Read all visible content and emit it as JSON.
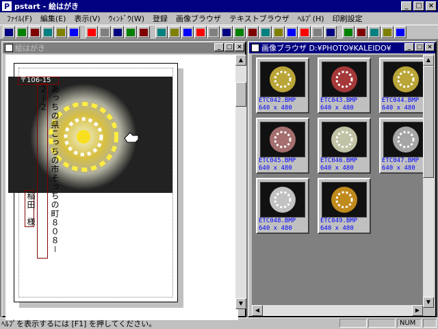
{
  "app": {
    "title": "pstart - 絵はがき"
  },
  "menu": [
    "ﾌｧｲﾙ(F)",
    "編集(E)",
    "表示(V)",
    "ｳｨﾝﾄﾞｳ(W)",
    "登録",
    "画像ブラウザ",
    "テキストブラウザ",
    "ﾍﾙﾌﾟ(H)",
    "印刷設定"
  ],
  "toolbar_icons": [
    "new-icon",
    "open-icon",
    "save-icon",
    "save-all-icon",
    "print-icon",
    "print-preview-icon",
    "page-icon",
    "move-down-icon",
    "move-all-icon",
    "flip-icon",
    "paste-icon",
    "align-top-icon",
    "align-middle-icon",
    "align-width-icon",
    "triangle-icon",
    "align-left-icon",
    "align-center-icon",
    "align-right-icon",
    "align-bottom-icon",
    "distribute-icon",
    "stretch-icon",
    "fit-icon",
    "group-icon",
    "ungroup-icon",
    "order-icon",
    "text-icon",
    "style-icon",
    "vertical-text-icon",
    "horizontal-text-icon",
    "help-icon"
  ],
  "left_window": {
    "title": "絵はがき",
    "postal": "〒106-15",
    "address": "あっちの県こっちの市そっちの町８０８－２－２",
    "name_a": "稲田",
    "name_b": "様"
  },
  "right_window": {
    "title": "画像ブラウザ D:¥PHOTO¥KALEIDO¥",
    "items": [
      {
        "file": "ETC042.BMP",
        "size": "640 x 480"
      },
      {
        "file": "ETC043.BMP",
        "size": "640 x 480"
      },
      {
        "file": "ETC044.BMP",
        "size": "640 x 480"
      },
      {
        "file": "ETC045.BMP",
        "size": "640 x 480"
      },
      {
        "file": "ETC046.BMP",
        "size": "640 x 480"
      },
      {
        "file": "ETC047.BMP",
        "size": "640 x 480"
      },
      {
        "file": "ETC048.BMP",
        "size": "640 x 480"
      },
      {
        "file": "ETC049.BMP",
        "size": "640 x 480"
      }
    ]
  },
  "status": {
    "help": "ﾍﾙﾌﾟを表示するには [F1] を押してください。",
    "num": "NUM"
  },
  "colors": {
    "title_active": "#000080",
    "face": "#c0c0c0",
    "label": "#0000ff"
  }
}
